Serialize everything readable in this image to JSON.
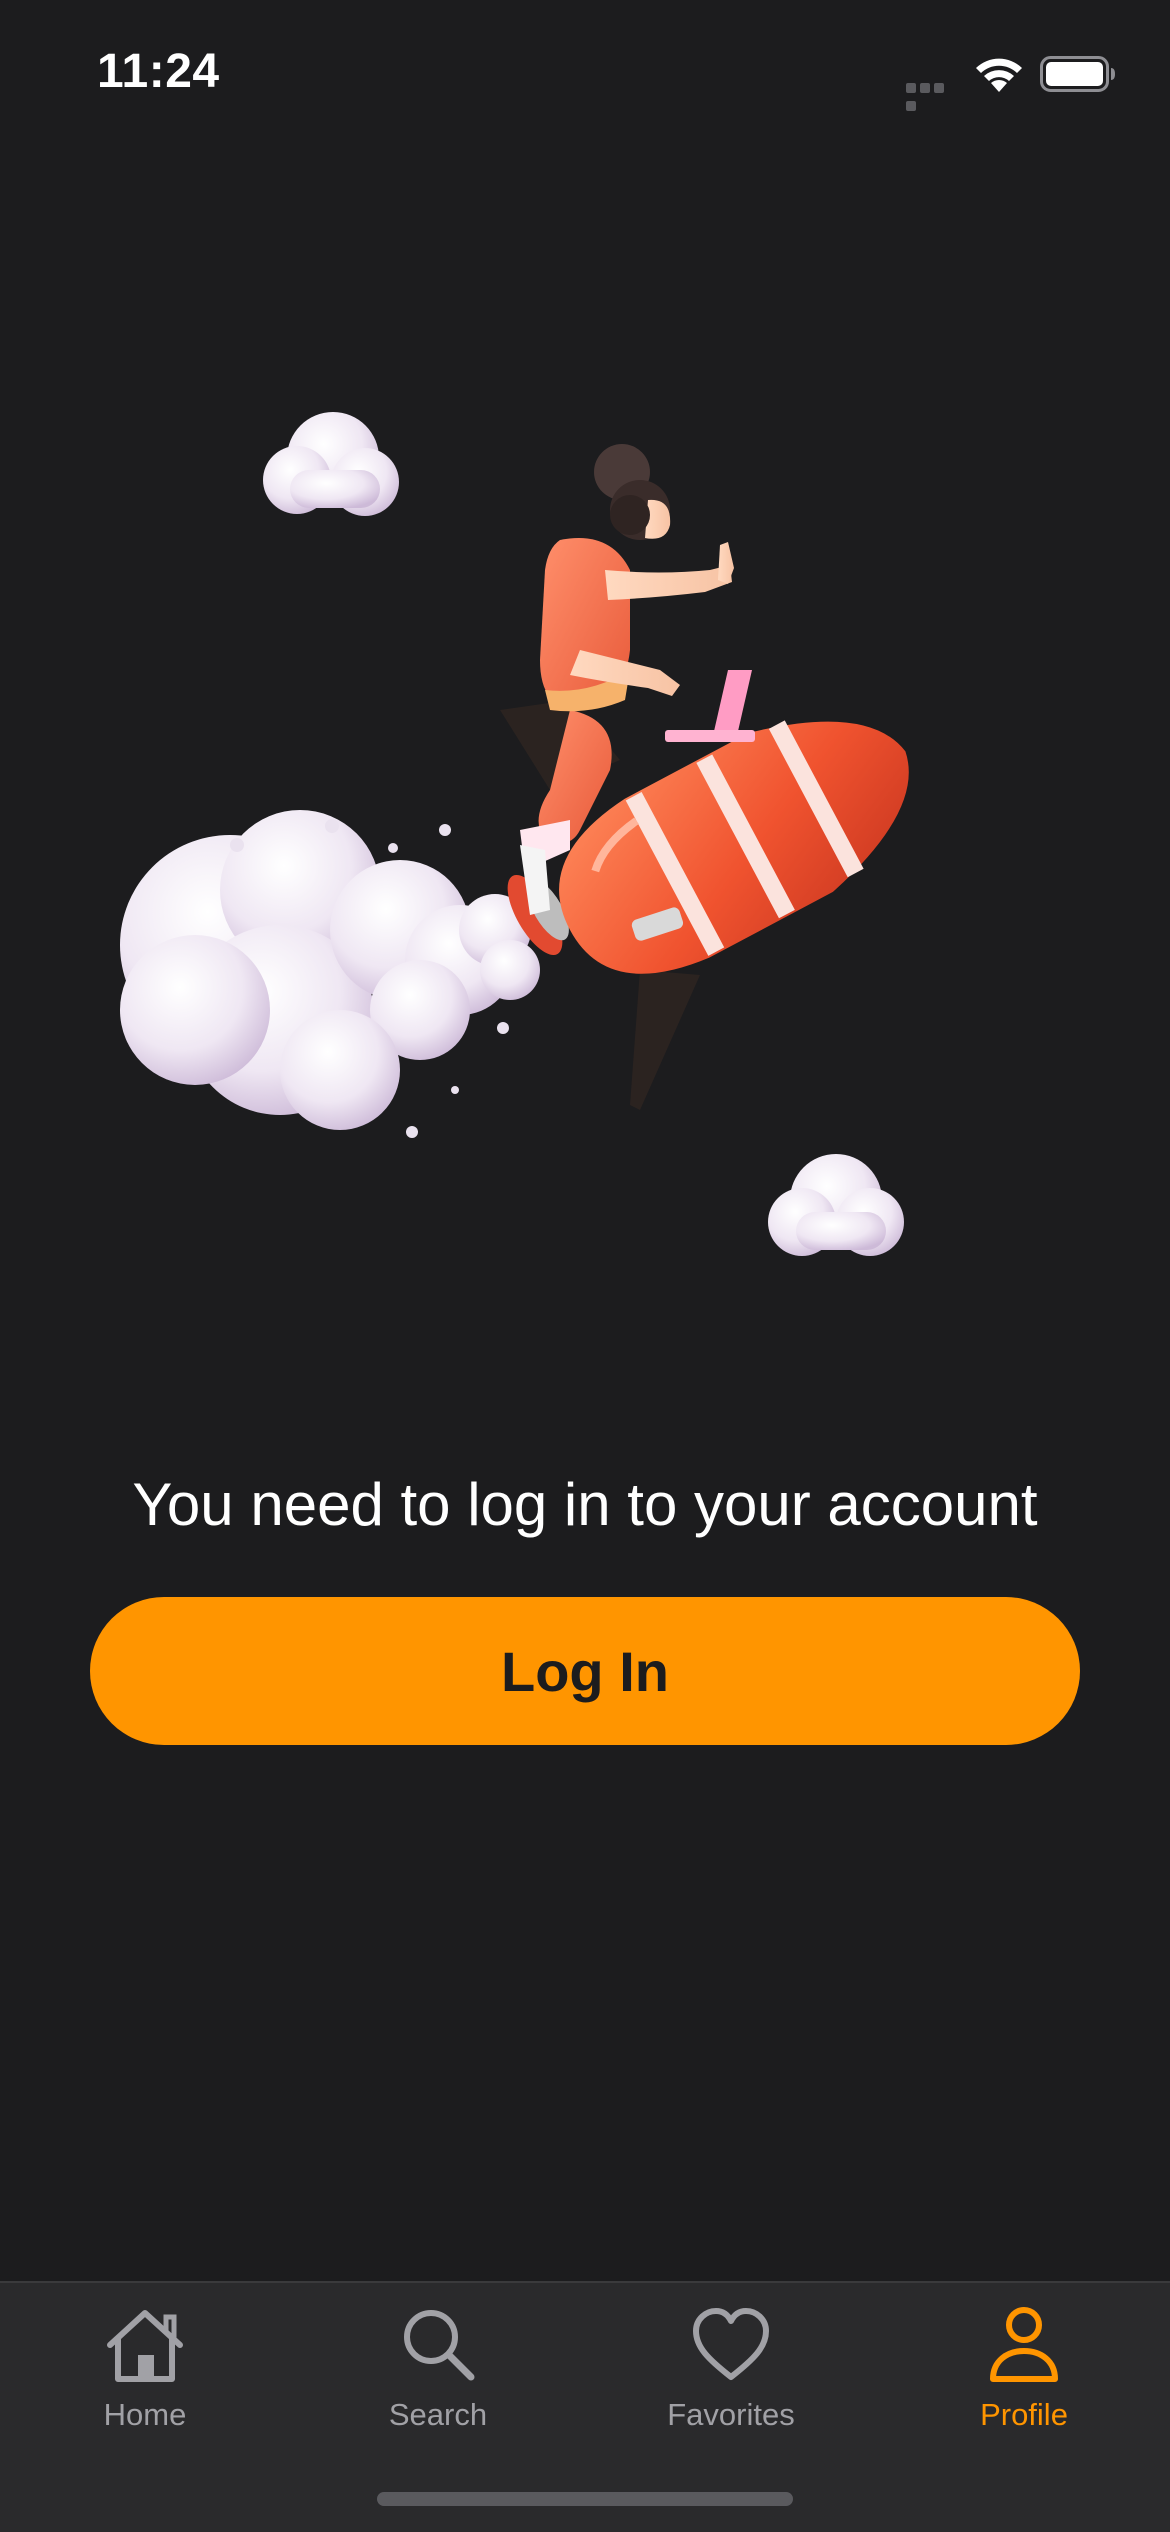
{
  "status_bar": {
    "time": "11:24"
  },
  "main": {
    "message": "You need to log in to your account",
    "login_label": "Log In"
  },
  "tab_bar": {
    "tabs": [
      {
        "label": "Home",
        "icon": "house-icon",
        "active": false
      },
      {
        "label": "Search",
        "icon": "magnifier-icon",
        "active": false
      },
      {
        "label": "Favorites",
        "icon": "heart-icon",
        "active": false
      },
      {
        "label": "Profile",
        "icon": "person-icon",
        "active": true
      }
    ]
  },
  "colors": {
    "background": "#1c1c1e",
    "accent": "#ff9500",
    "tab_inactive": "#a1a1a6",
    "tab_bar_bg": "#2a2a2c"
  }
}
